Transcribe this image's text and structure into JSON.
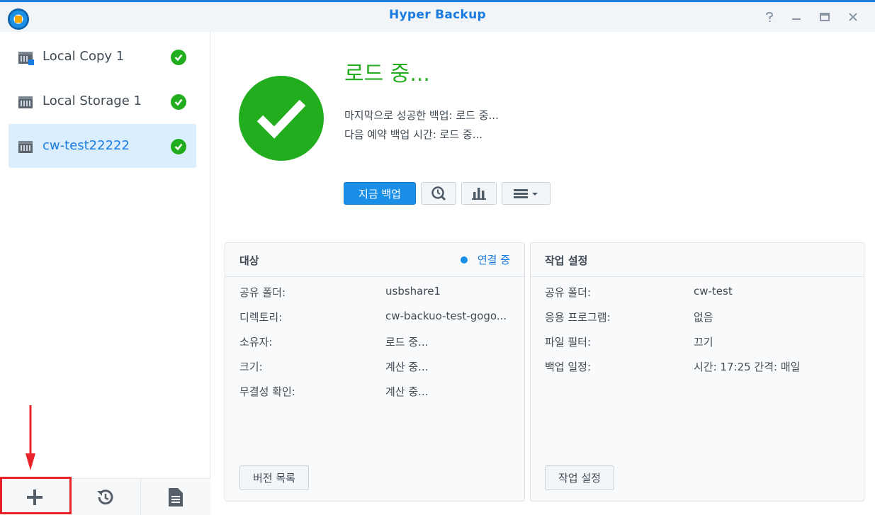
{
  "window": {
    "title": "Hyper Backup",
    "controls": [
      "help-icon",
      "minimize-icon",
      "maximize-icon",
      "close-icon"
    ]
  },
  "sidebar": {
    "items": [
      {
        "label": "Local Copy 1",
        "icon": "local-copy-device-icon",
        "status": "success",
        "selected": false
      },
      {
        "label": "Local Storage 1",
        "icon": "storage-device-icon",
        "status": "success",
        "selected": false
      },
      {
        "label": "cw-test22222",
        "icon": "storage-device-icon",
        "status": "success",
        "selected": true
      }
    ],
    "bottom_buttons": [
      "plus-icon",
      "restore-history-icon",
      "log-document-icon"
    ]
  },
  "status": {
    "title": "로드 중...",
    "last_success": "마지막으로 성공한 백업: 로드 중...",
    "next_schedule": "다음 예약 백업 시간: 로드 중..."
  },
  "actions": {
    "backup_now": "지금 백업",
    "icons": [
      "version-browser-icon",
      "statistics-icon",
      "menu-icon"
    ]
  },
  "target_panel": {
    "title": "대상",
    "connection": "연결 중",
    "rows": [
      {
        "label": "공유 폴더:",
        "value": "usbshare1"
      },
      {
        "label": "디렉토리:",
        "value": "cw-backuo-test-gogo..."
      },
      {
        "label": "소유자:",
        "value": "로드 중..."
      },
      {
        "label": "크기:",
        "value": "계산 중..."
      },
      {
        "label": "무결성 확인:",
        "value": "계산 중..."
      }
    ],
    "button": "버전 목록"
  },
  "task_panel": {
    "title": "작업 설정",
    "rows": [
      {
        "label": "공유 폴더:",
        "value": "cw-test"
      },
      {
        "label": "응용 프로그램:",
        "value": "없음"
      },
      {
        "label": "파일 필터:",
        "value": "끄기"
      },
      {
        "label": "백업 일정:",
        "value": "시간: 17:25 간격: 매일"
      }
    ],
    "button": "작업 설정"
  },
  "colors": {
    "accent": "#1a7be0",
    "success": "#22ad1f",
    "annotation": "#e8232a"
  }
}
